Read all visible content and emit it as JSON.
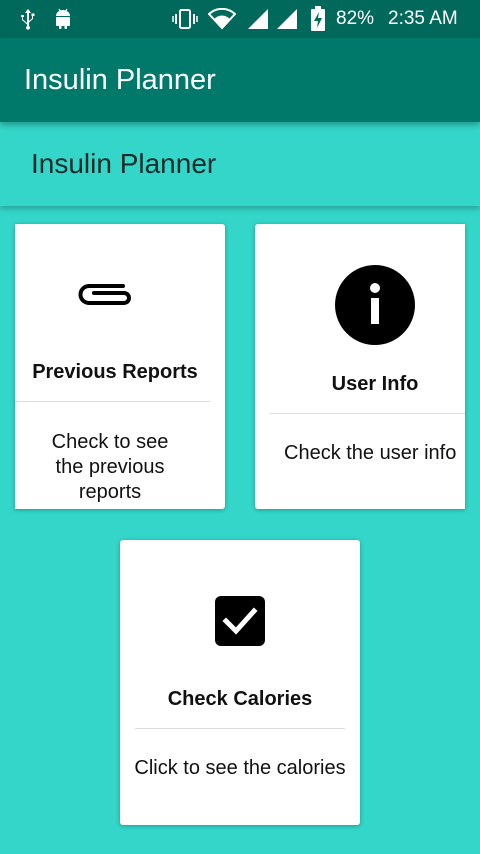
{
  "status_bar": {
    "icons": [
      "usb-icon",
      "android-icon",
      "vibrate-icon",
      "wifi-icon",
      "signal-icon",
      "signal-icon",
      "battery-charging-icon"
    ],
    "battery": "82%",
    "time": "2:35 AM"
  },
  "app_bar": {
    "title": "Insulin Planner"
  },
  "header": {
    "title": "Insulin Planner"
  },
  "cards": [
    {
      "icon": "paperclip-icon",
      "title": "Previous Reports",
      "description": "Check to see the previous reports"
    },
    {
      "icon": "info-icon",
      "title": "User Info",
      "description": "Check the user info"
    },
    {
      "icon": "checkbox-checked-icon",
      "title": "Check Calories",
      "description": "Click to see the calories"
    }
  ],
  "colors": {
    "status_bar": "#00695c",
    "app_bar": "#00796b",
    "background": "#33d6c8",
    "card": "#ffffff"
  }
}
